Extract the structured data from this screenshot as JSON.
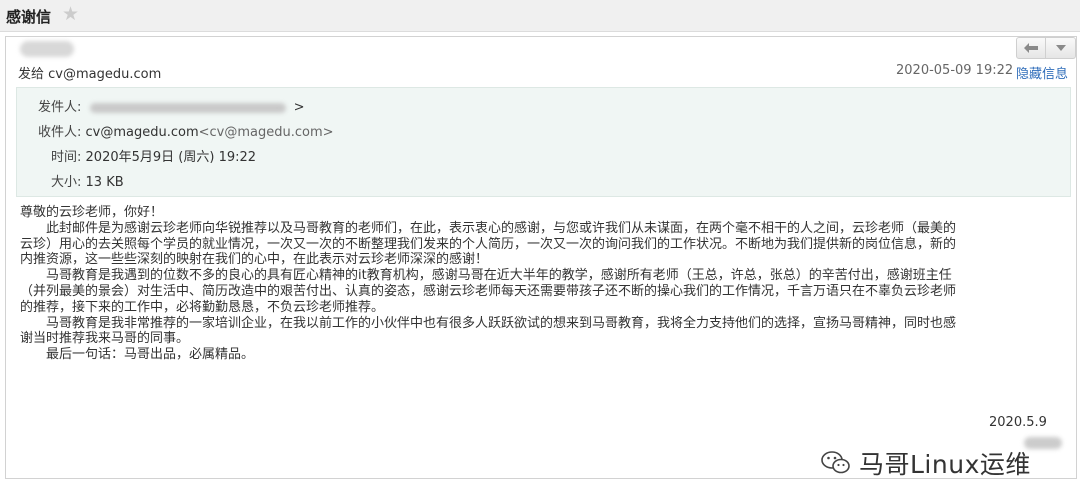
{
  "header": {
    "subject": "感谢信"
  },
  "message": {
    "send_to_prefix": "发给",
    "send_to_address": "cv@magedu.com",
    "datetime": "2020-05-09 19:22",
    "hide_info_label": "隐藏信息"
  },
  "details": {
    "from_label": "发件人:",
    "from_suffix": ">",
    "to_label": "收件人:",
    "to_name": "cv@magedu.com",
    "to_address": "<cv@magedu.com>",
    "time_label": "时间:",
    "time_value": "2020年5月9日 (周六) 19:22",
    "size_label": "大小:",
    "size_value": "13 KB"
  },
  "body": {
    "lines": [
      "尊敬的云珍老师，你好！",
      "此封邮件是为感谢云珍老师向华锐推荐以及马哥教育的老师们，在此，表示衷心的感谢，与您或许我们从未谋面，在两个毫不相干的人之间，云珍老师（最美的",
      "云珍）用心的去关照每个学员的就业情况，一次又一次的不断整理我们发来的个人简历，一次又一次的询问我们的工作状况。不断地为我们提供新的岗位信息，新的",
      "内推资源，这一些些深刻的映射在我们的心中，在此表示对云珍老师深深的感谢！",
      "马哥教育是我遇到的位数不多的良心的具有匠心精神的it教育机构，感谢马哥在近大半年的教学，感谢所有老师（王总，许总，张总）的辛苦付出，感谢班主任",
      "（并列最美的景会）对生活中、简历改造中的艰苦付出、认真的姿态，感谢云珍老师每天还需要带孩子还不断的操心我们的工作情况，千言万语只在不辜负云珍老师",
      "的推荐，接下来的工作中，必将勤勤恳恳，不负云珍老师推荐。",
      "马哥教育是我非常推荐的一家培训企业，在我以前工作的小伙伴中也有很多人跃跃欲试的想来到马哥教育，我将全力支持他们的选择，宣扬马哥精神，同时也感",
      "谢当时推荐我来马哥的同事。",
      "最后一句话：马哥出品，必属精品。"
    ],
    "signature_date": "2020.5.9"
  },
  "watermark": {
    "text": "马哥Linux运维"
  },
  "icons": {
    "star": "star-icon",
    "back": "back-arrow-icon",
    "more": "chevron-down-icon",
    "watermark_logo": "wechat-icon"
  },
  "colors": {
    "link": "#2f6dba",
    "info_panel": "#f0f6f4",
    "topbar": "#f0f0f0"
  }
}
